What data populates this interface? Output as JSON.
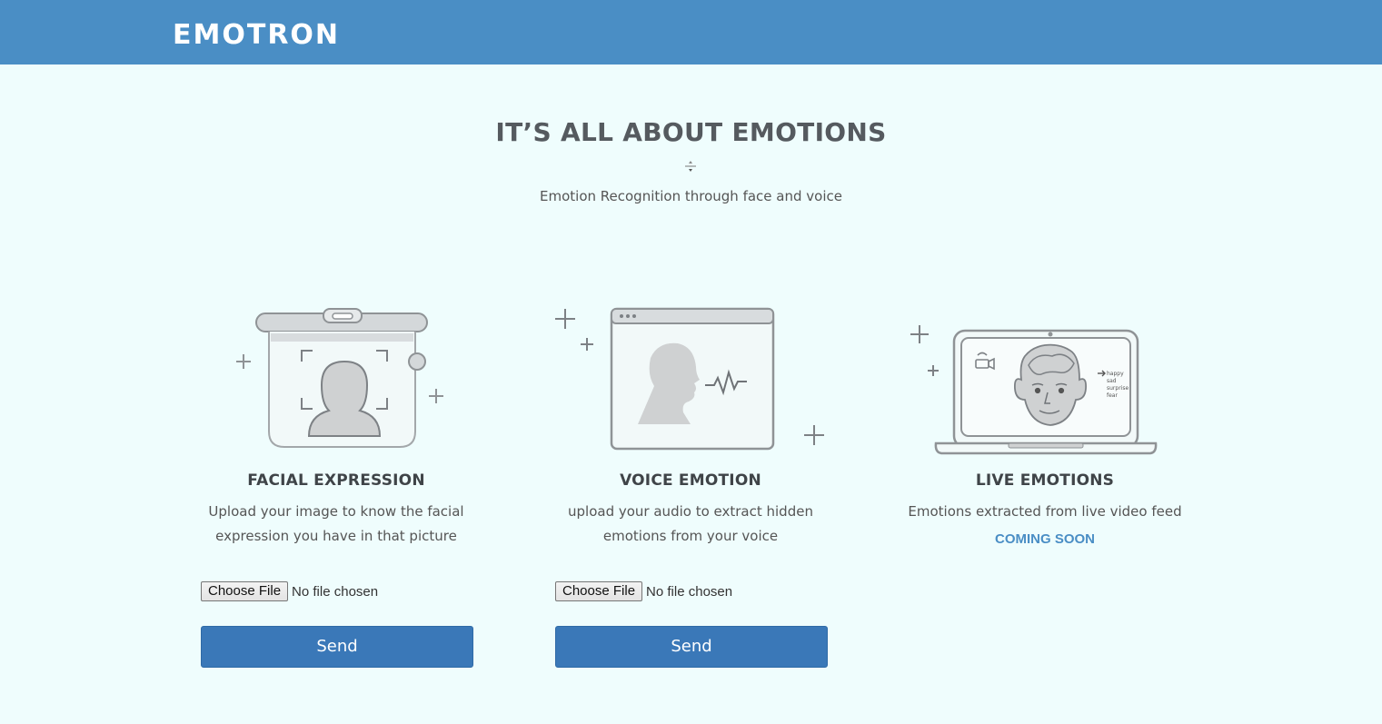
{
  "header": {
    "brand": "EMOTRON",
    "bg_color": "#4a8ec5"
  },
  "hero": {
    "title": "IT’S ALL ABOUT EMOTIONS",
    "subtitle": "Emotion Recognition through face and voice"
  },
  "cards": [
    {
      "title": "FACIAL EXPRESSION",
      "description": "Upload your image to know the facial expression you have in that picture",
      "illustration_icon": "face-scan-illustration-icon",
      "file_input": {
        "button_label": "Choose File",
        "status": "No file chosen"
      },
      "send_label": "Send"
    },
    {
      "title": "VOICE EMOTION",
      "description": "upload your audio to extract hidden emotions from your voice",
      "illustration_icon": "voice-waveform-illustration-icon",
      "file_input": {
        "button_label": "Choose File",
        "status": "No file chosen"
      },
      "send_label": "Send"
    },
    {
      "title": "LIVE EMOTIONS",
      "description": "Emotions extracted from live video feed",
      "illustration_icon": "laptop-video-face-illustration-icon",
      "coming_soon": "COMING SOON",
      "screen_labels": [
        "happy",
        "sad",
        "surprise",
        "fear"
      ]
    }
  ],
  "colors": {
    "page_bg": "#effdfd",
    "accent": "#4a8ec5",
    "button_bg": "#3a78b8",
    "heading_text": "#555a5f"
  }
}
